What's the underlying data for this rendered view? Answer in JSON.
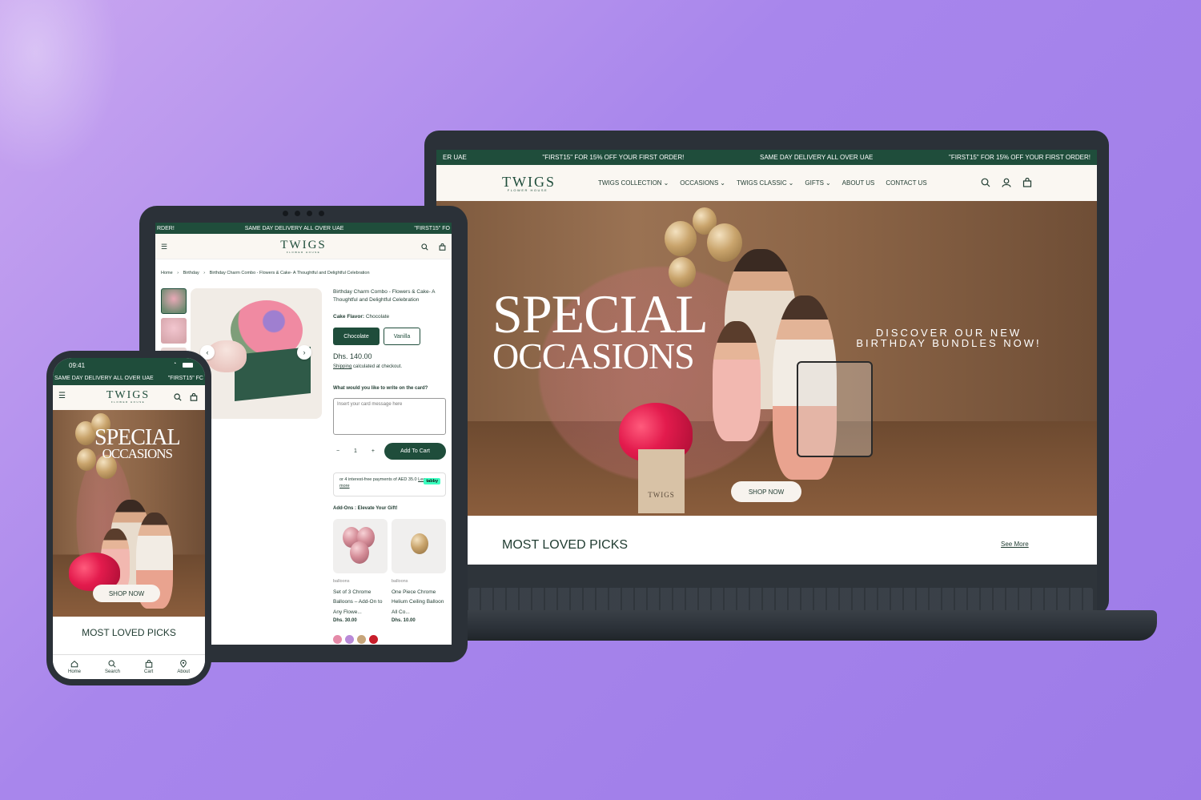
{
  "colors": {
    "brand_green": "#1f4d3b",
    "background": "#a886ec",
    "device": "#2b3138"
  },
  "laptop": {
    "marquee": [
      "ER UAE",
      "\"FIRST15\" FOR 15% OFF YOUR FIRST ORDER!",
      "SAME DAY DELIVERY ALL OVER UAE",
      "\"FIRST15\" FOR 15% OFF YOUR FIRST ORDER!"
    ],
    "logo": "TWIGS",
    "logo_sub": "FLOWER HOUSE",
    "nav": [
      "TWIGS COLLECTION",
      "OCCASIONS",
      "TWIGS CLASSIC",
      "GIFTS",
      "ABOUT US",
      "CONTACT US"
    ],
    "hero_title_1": "SPECIAL",
    "hero_title_2": "OCCASIONS",
    "hero_tagline_1": "DISCOVER OUR NEW",
    "hero_tagline_2": "BIRTHDAY BUNDLES NOW!",
    "shop_now": "SHOP NOW",
    "bag_logo": "TWIGS",
    "section_title": "MOST LOVED PICKS",
    "see_more": "See More",
    "icons": [
      "search-icon",
      "user-icon",
      "bag-icon"
    ]
  },
  "tablet": {
    "marquee": [
      "RDER!",
      "SAME DAY DELIVERY ALL OVER UAE",
      "\"FIRST15\" FO"
    ],
    "logo": "TWIGS",
    "logo_sub": "FLOWER HOUSE",
    "breadcrumb": [
      "Home",
      "Birthday",
      "Birthday Charm Combo - Flowers & Cake- A Thoughtful and Delightful Celebration"
    ],
    "product_title": "Birthday Charm Combo - Flowers & Cake- A Thoughtful and Delightful Celebration",
    "flavor_label": "Cake Flavor:",
    "flavor_value": "Chocolate",
    "flavor_options": [
      "Chocolate",
      "Vanilla"
    ],
    "price": "Dhs. 140.00",
    "shipping_link": "Shipping",
    "shipping_note": "calculated at checkout.",
    "card_question": "What would you like to write on the card?",
    "card_placeholder": "Insert your card message here",
    "quantity": "1",
    "qty_minus": "−",
    "qty_plus": "+",
    "add_to_cart": "Add To Cart",
    "tabby_text": "or 4 interest-free payments of AED 35.0",
    "tabby_learn": "Learn more",
    "tabby_badge": "tabby",
    "addons_title": "Add-Ons : Elevate Your Gift!",
    "addons": [
      {
        "category": "balloons",
        "name": "Set of 3 Chrome Balloons – Add-On to Any Flowe...",
        "price": "Dhs. 30.00"
      },
      {
        "category": "balloons",
        "name": "One Piece Chrome Helium Ceiling Balloon All Co...",
        "price": "Dhs. 10.00"
      }
    ],
    "swatches": [
      "#e58aa8",
      "#b98ad8",
      "#c7a57a",
      "#c81d2a"
    ]
  },
  "phone": {
    "time": "09:41",
    "marquee": [
      "SAME DAY DELIVERY ALL OVER UAE",
      "\"FIRST15\" FC"
    ],
    "logo": "TWIGS",
    "logo_sub": "FLOWER HOUSE",
    "hero_title_1": "SPECIAL",
    "hero_title_2": "OCCASIONS",
    "shop_now": "SHOP NOW",
    "section_title": "MOST LOVED PICKS",
    "tabs": [
      "Home",
      "Search",
      "Cart",
      "About"
    ]
  }
}
